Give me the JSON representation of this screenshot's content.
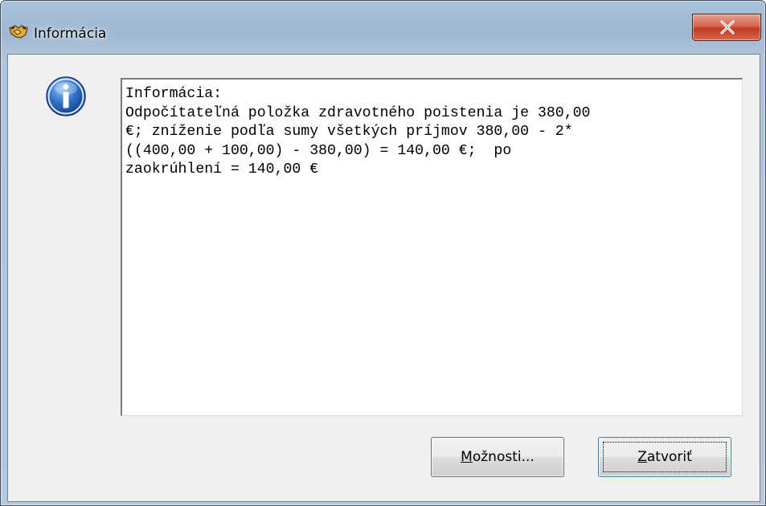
{
  "window": {
    "title": "Informácia",
    "app_icon": "handshake-icon",
    "close_icon": "close-x-icon"
  },
  "dialog": {
    "icon": "information-icon",
    "message_lines": [
      "Informácia:",
      "Odpočítateľná položka zdravotného poistenia je 380,00",
      "€; zníženie podľa sumy všetkých príjmov 380,00 - 2*",
      "((400,00 + 100,00) - 380,00) = 140,00 €;  po",
      "zaokrúhlení = 140,00 €"
    ]
  },
  "buttons": {
    "options": {
      "mnemonic": "M",
      "rest": "ožnosti..."
    },
    "close": {
      "mnemonic": "Z",
      "rest": "atvoriť"
    }
  },
  "colors": {
    "title_bar": "#a9c2dc",
    "close_button": "#c0391f",
    "dialog_background": "#f0f0f0",
    "info_icon_blue": "#2563b8"
  }
}
